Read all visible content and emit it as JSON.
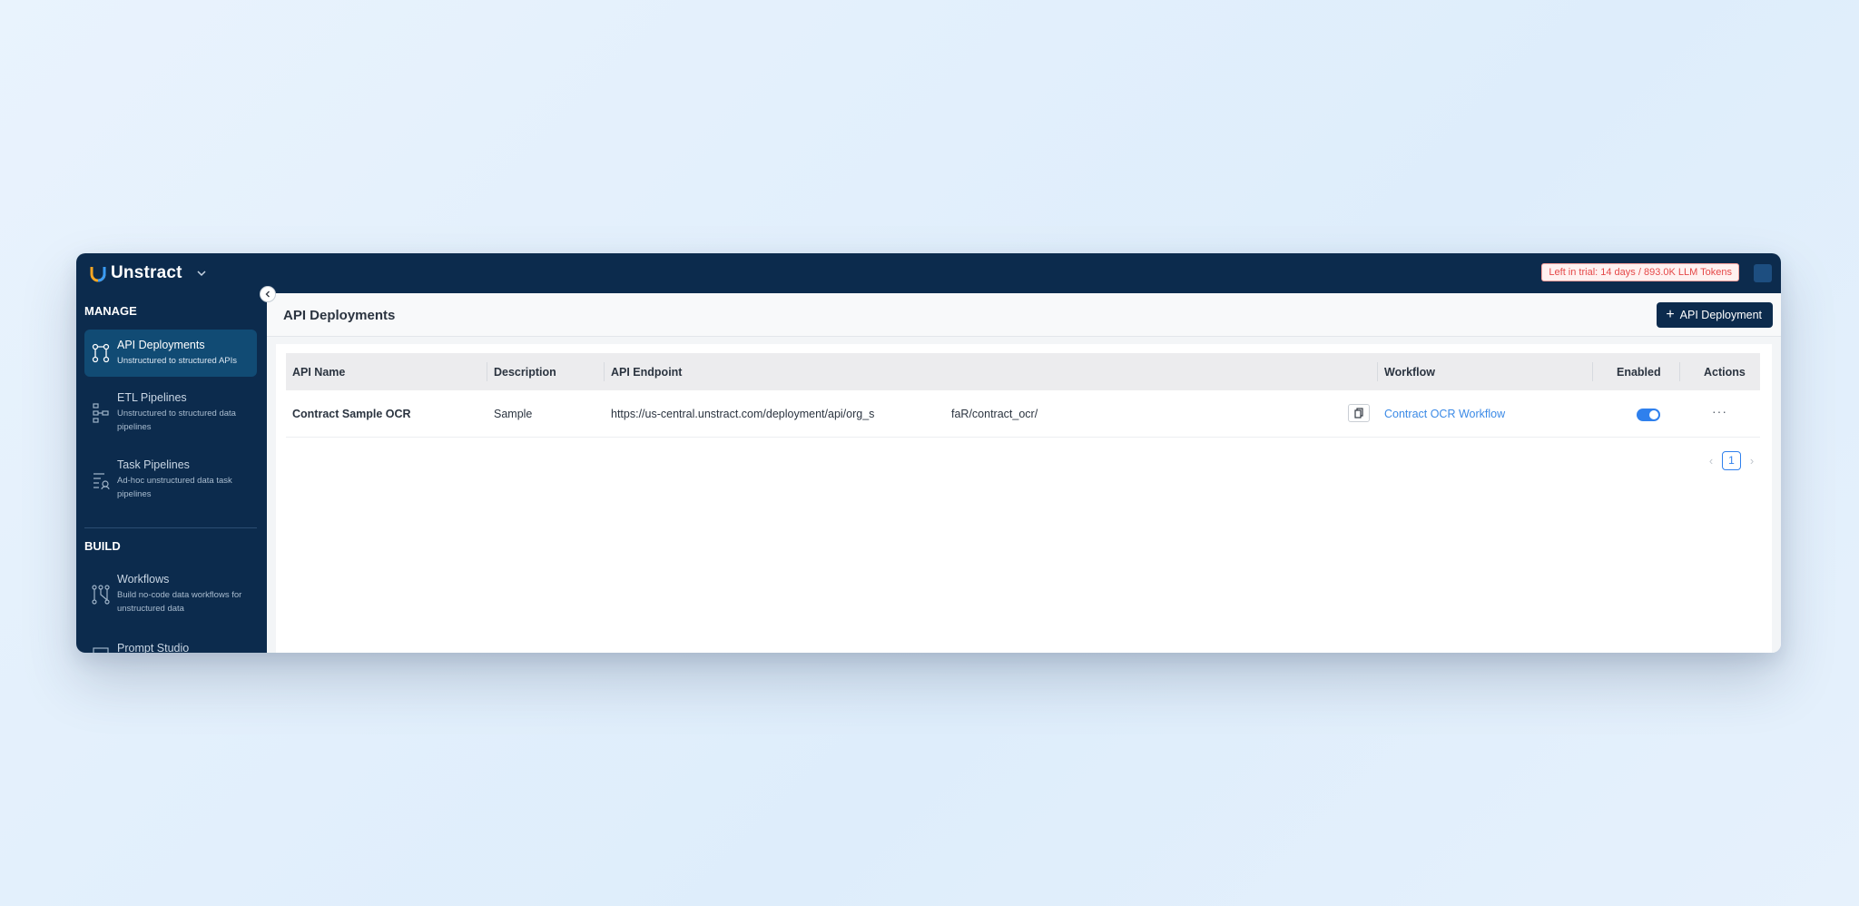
{
  "app": {
    "name": "Unstract",
    "trial_badge": "Left in trial: 14 days / 893.0K LLM Tokens"
  },
  "sidebar": {
    "sections": [
      {
        "title": "MANAGE",
        "items": [
          {
            "title": "API Deployments",
            "desc": "Unstructured to structured APIs",
            "icon": "api-deployments-icon",
            "active": true
          },
          {
            "title": "ETL Pipelines",
            "desc": "Unstructured to structured data pipelines",
            "icon": "etl-pipelines-icon",
            "active": false
          },
          {
            "title": "Task Pipelines",
            "desc": "Ad-hoc unstructured data task pipelines",
            "icon": "task-pipelines-icon",
            "active": false
          }
        ]
      },
      {
        "title": "BUILD",
        "items": [
          {
            "title": "Workflows",
            "desc": "Build no-code data workflows for unstructured data",
            "icon": "workflows-icon",
            "active": false
          },
          {
            "title": "Prompt Studio",
            "desc": "",
            "icon": "prompt-studio-icon",
            "active": false
          }
        ]
      }
    ]
  },
  "page": {
    "title": "API Deployments",
    "add_button_label": "API Deployment"
  },
  "table": {
    "columns": [
      "API Name",
      "Description",
      "API Endpoint",
      "Workflow",
      "Enabled",
      "Actions"
    ],
    "rows": [
      {
        "api_name": "Contract Sample OCR",
        "description": "Sample",
        "endpoint_start": "https://us-central.unstract.com/deployment/api/org_s",
        "endpoint_end": "faR/contract_ocr/",
        "workflow": "Contract OCR Workflow",
        "enabled": true,
        "actions": "···"
      }
    ]
  },
  "pagination": {
    "current_page": "1"
  },
  "colors": {
    "navy": "#0c2b4d",
    "active_nav": "#114b74",
    "link_blue": "#3b8ae6",
    "toggle_blue": "#2f80ed",
    "trial_red": "#e54848"
  }
}
